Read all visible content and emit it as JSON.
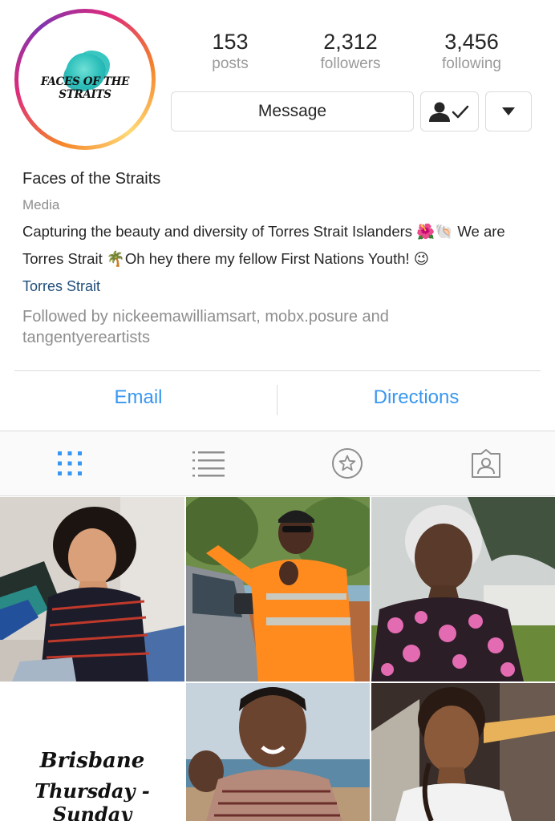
{
  "profile": {
    "avatar_text": "FACES OF THE STRAITS",
    "stats": [
      {
        "value": "153",
        "label": "posts"
      },
      {
        "value": "2,312",
        "label": "followers"
      },
      {
        "value": "3,456",
        "label": "following"
      }
    ],
    "message_label": "Message",
    "following_icon": "person-check-icon",
    "dropdown_icon": "caret-down-icon"
  },
  "bio": {
    "name": "Faces of the Straits",
    "category": "Media",
    "description": "Capturing the beauty and diversity of Torres Strait Islanders 🌺🐚 We are Torres Strait 🌴Oh hey there my fellow First Nations Youth! 😉",
    "location": "Torres Strait",
    "followed_by": "Followed by nickeemawilliamsart, mobx.posure and tangentyereartists"
  },
  "contact": {
    "email_label": "Email",
    "directions_label": "Directions"
  },
  "tabs": [
    {
      "icon": "grid-icon",
      "active": true
    },
    {
      "icon": "list-icon",
      "active": false
    },
    {
      "icon": "star-icon",
      "active": false
    },
    {
      "icon": "tagged-icon",
      "active": false
    }
  ],
  "posts": [
    {
      "description": "photo of a smiling young woman with curly hair"
    },
    {
      "description": "photo of a man in an orange hi-vis shirt"
    },
    {
      "description": "photo of an elderly woman outdoors"
    },
    {
      "line1": "Brisbane",
      "line2": "Thursday - Sunday"
    },
    {
      "description": "photo of a smiling man by the water"
    },
    {
      "description": "photo of a young girl smiling"
    }
  ],
  "colors": {
    "link_blue": "#3897f0",
    "location_blue": "#1f4d7a",
    "muted_gray": "#8e8e8e",
    "border": "#dbdbdb"
  }
}
